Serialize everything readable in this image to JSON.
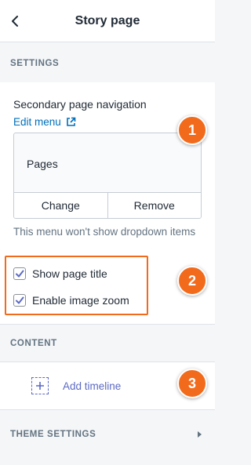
{
  "header": {
    "title": "Story page",
    "back_icon": "chevron-left-icon"
  },
  "sections": {
    "settings": "SETTINGS",
    "content": "CONTENT",
    "theme_settings": "THEME SETTINGS"
  },
  "navigation": {
    "label": "Secondary page navigation",
    "edit_menu": "Edit menu",
    "edit_menu_icon": "external-link-icon",
    "selected_menu": "Pages",
    "change_label": "Change",
    "remove_label": "Remove",
    "help_text": "This menu won't show dropdown items"
  },
  "checkboxes": [
    {
      "label": "Show page title",
      "checked": true
    },
    {
      "label": "Enable image zoom",
      "checked": true
    }
  ],
  "content": {
    "add_timeline": "Add timeline",
    "add_icon": "add-block-icon"
  },
  "badges": [
    "1",
    "2",
    "3"
  ],
  "colors": {
    "accent": "#f26a1b",
    "link": "#006fbb",
    "indigo": "#5c6ac4",
    "muted": "#637381",
    "background": "#f4f6f8"
  }
}
